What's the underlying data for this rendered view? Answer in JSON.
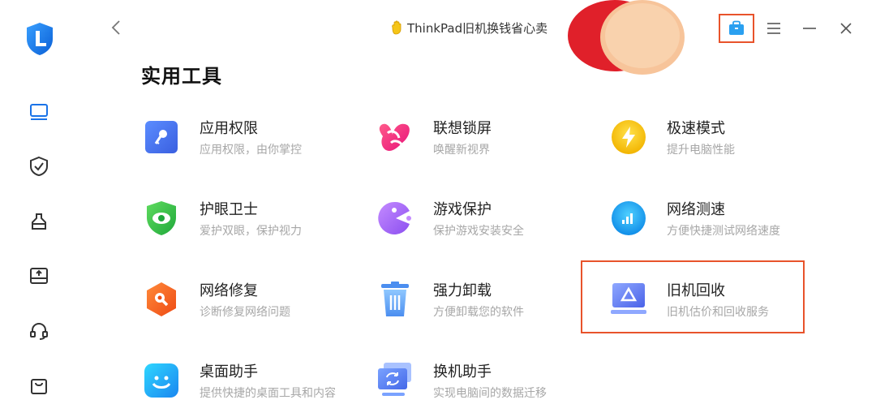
{
  "header": {
    "promo_text": "ThinkPad旧机换钱省心卖"
  },
  "page_title": "实用工具",
  "colors": {
    "accent": "#1a73e8",
    "highlight_border": "#e8532b"
  },
  "sidebar": {
    "items": [
      {
        "icon": "monitor-icon"
      },
      {
        "icon": "shield-check-icon"
      },
      {
        "icon": "clean-icon"
      },
      {
        "icon": "download-box-icon"
      },
      {
        "icon": "headset-icon"
      },
      {
        "icon": "shopping-bag-icon"
      }
    ]
  },
  "tools": [
    {
      "name": "应用权限",
      "desc": "应用权限，由你掌控",
      "icon": "key-icon"
    },
    {
      "name": "联想锁屏",
      "desc": "唤醒新视界",
      "icon": "lock-screen-icon"
    },
    {
      "name": "极速模式",
      "desc": "提升电脑性能",
      "icon": "lightning-icon"
    },
    {
      "name": "护眼卫士",
      "desc": "爱护双眼，保护视力",
      "icon": "eye-shield-icon"
    },
    {
      "name": "游戏保护",
      "desc": "保护游戏安装安全",
      "icon": "pacman-icon"
    },
    {
      "name": "网络测速",
      "desc": "方便快捷测试网络速度",
      "icon": "signal-icon"
    },
    {
      "name": "网络修复",
      "desc": "诊断修复网络问题",
      "icon": "wrench-hex-icon"
    },
    {
      "name": "强力卸载",
      "desc": "方便卸载您的软件",
      "icon": "trash-icon"
    },
    {
      "name": "旧机回收",
      "desc": "旧机估价和回收服务",
      "icon": "recycle-laptop-icon"
    },
    {
      "name": "桌面助手",
      "desc": "提供快捷的桌面工具和内容",
      "icon": "smile-face-icon"
    },
    {
      "name": "换机助手",
      "desc": "实现电脑间的数据迁移",
      "icon": "migrate-monitor-icon"
    }
  ]
}
